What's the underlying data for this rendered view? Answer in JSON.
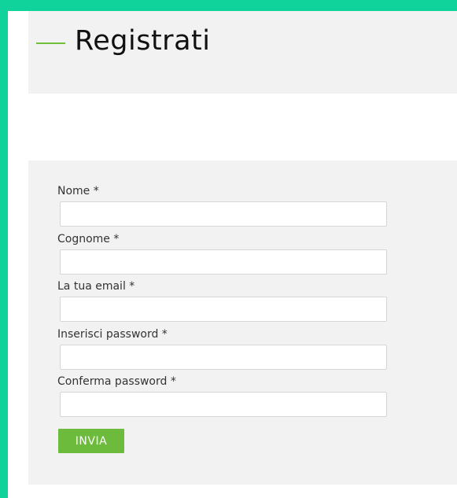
{
  "page": {
    "title": "Registrati"
  },
  "form": {
    "fields": [
      {
        "label": "Nome *",
        "value": "",
        "placeholder": ""
      },
      {
        "label": "Cognome *",
        "value": "",
        "placeholder": ""
      },
      {
        "label": "La tua email *",
        "value": "",
        "placeholder": ""
      },
      {
        "label": "Inserisci password *",
        "value": "",
        "placeholder": ""
      },
      {
        "label": "Conferma password *",
        "value": "",
        "placeholder": ""
      }
    ],
    "submit_label": "INVIA"
  },
  "colors": {
    "frame": "#10d39b",
    "accent": "#6cbb3c",
    "band": "#f2f2f2"
  }
}
